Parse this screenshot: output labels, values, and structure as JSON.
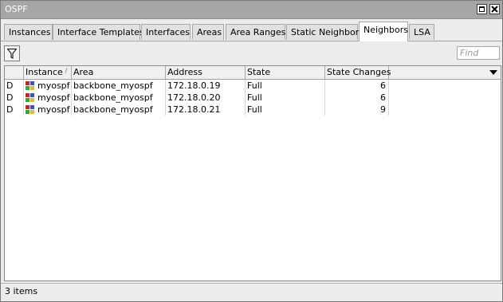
{
  "window": {
    "title": "OSPF"
  },
  "tabs": [
    {
      "label": "Instances"
    },
    {
      "label": "Interface Templates"
    },
    {
      "label": "Interfaces"
    },
    {
      "label": "Areas"
    },
    {
      "label": "Area Ranges"
    },
    {
      "label": "Static Neighbors"
    },
    {
      "label": "Neighbors"
    },
    {
      "label": "LSA"
    }
  ],
  "active_tab": "Neighbors",
  "toolbar": {
    "find_placeholder": "Find",
    "filter_icon": "filter-icon"
  },
  "table": {
    "columns": [
      "Instance",
      "Area",
      "Address",
      "State",
      "State Changes"
    ],
    "sorted_column": "Instance",
    "rows": [
      {
        "flag": "D",
        "instance": "myospf",
        "area": "backbone_myospf",
        "address": "172.18.0.19",
        "state": "Full",
        "state_changes": "6"
      },
      {
        "flag": "D",
        "instance": "myospf",
        "area": "backbone_myospf",
        "address": "172.18.0.20",
        "state": "Full",
        "state_changes": "6"
      },
      {
        "flag": "D",
        "instance": "myospf",
        "area": "backbone_myospf",
        "address": "172.18.0.21",
        "state": "Full",
        "state_changes": "9"
      }
    ]
  },
  "status": {
    "items_text": "3 items"
  },
  "colors": {
    "titlebar": "#a6a6a6",
    "icon_red": "#cc2222",
    "icon_blue": "#3355cc",
    "icon_green": "#33aa33",
    "icon_yellow": "#e0c020"
  }
}
